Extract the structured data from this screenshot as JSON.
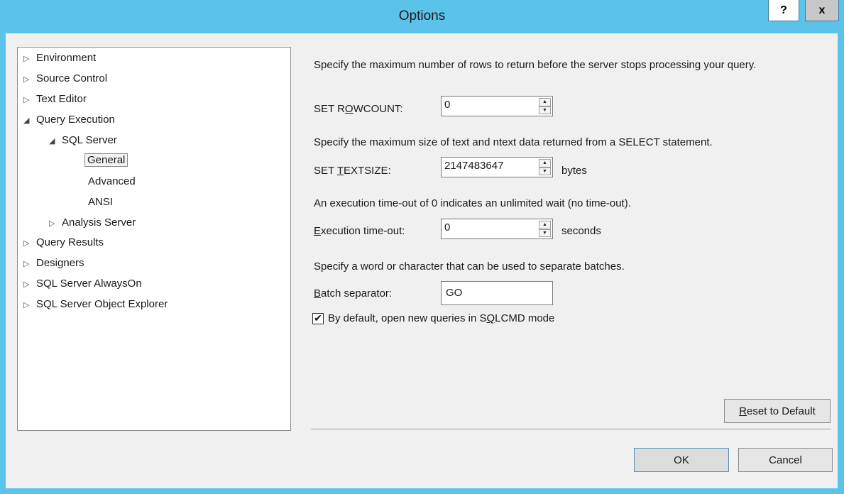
{
  "window": {
    "title": "Options",
    "help_label": "?",
    "close_label": "x"
  },
  "tree": {
    "items": [
      {
        "label": "Environment",
        "arrow": "▷",
        "level": 0
      },
      {
        "label": "Source Control",
        "arrow": "▷",
        "level": 0
      },
      {
        "label": "Text Editor",
        "arrow": "▷",
        "level": 0
      },
      {
        "label": "Query Execution",
        "arrow": "◢",
        "level": 0
      },
      {
        "label": "SQL Server",
        "arrow": "◢",
        "level": 1
      },
      {
        "label": "General",
        "arrow": "",
        "level": 2,
        "selected": true
      },
      {
        "label": "Advanced",
        "arrow": "",
        "level": 2
      },
      {
        "label": "ANSI",
        "arrow": "",
        "level": 2
      },
      {
        "label": "Analysis Server",
        "arrow": "▷",
        "level": 1
      },
      {
        "label": "Query Results",
        "arrow": "▷",
        "level": 0
      },
      {
        "label": "Designers",
        "arrow": "▷",
        "level": 0
      },
      {
        "label": "SQL Server AlwaysOn",
        "arrow": "▷",
        "level": 0
      },
      {
        "label": "SQL Server Object Explorer",
        "arrow": "▷",
        "level": 0
      }
    ]
  },
  "settings": {
    "rowcount_desc": "Specify the maximum number of rows to return before the server stops processing your query.",
    "rowcount_label_pre": "SET R",
    "rowcount_label_key": "O",
    "rowcount_label_post": "WCOUNT:",
    "rowcount_value": "0",
    "textsize_desc": "Specify the maximum size of text and ntext data returned from a SELECT statement.",
    "textsize_label_pre": "SET ",
    "textsize_label_key": "T",
    "textsize_label_post": "EXTSIZE:",
    "textsize_value": "2147483647",
    "textsize_unit": "bytes",
    "timeout_desc": "An execution time-out of 0 indicates an unlimited wait (no time-out).",
    "timeout_label_key": "E",
    "timeout_label_post": "xecution time-out:",
    "timeout_value": "0",
    "timeout_unit": "seconds",
    "batch_desc": "Specify a word or character that can be used to separate batches.",
    "batch_label_key": "B",
    "batch_label_post": "atch separator:",
    "batch_value": "GO",
    "sqlcmd_checked": true,
    "sqlcmd_label_pre": "By default, open new queries in S",
    "sqlcmd_label_key": "Q",
    "sqlcmd_label_post": "LCMD mode"
  },
  "buttons": {
    "reset_key": "R",
    "reset_post": "eset to Default",
    "ok": "OK",
    "cancel": "Cancel"
  }
}
